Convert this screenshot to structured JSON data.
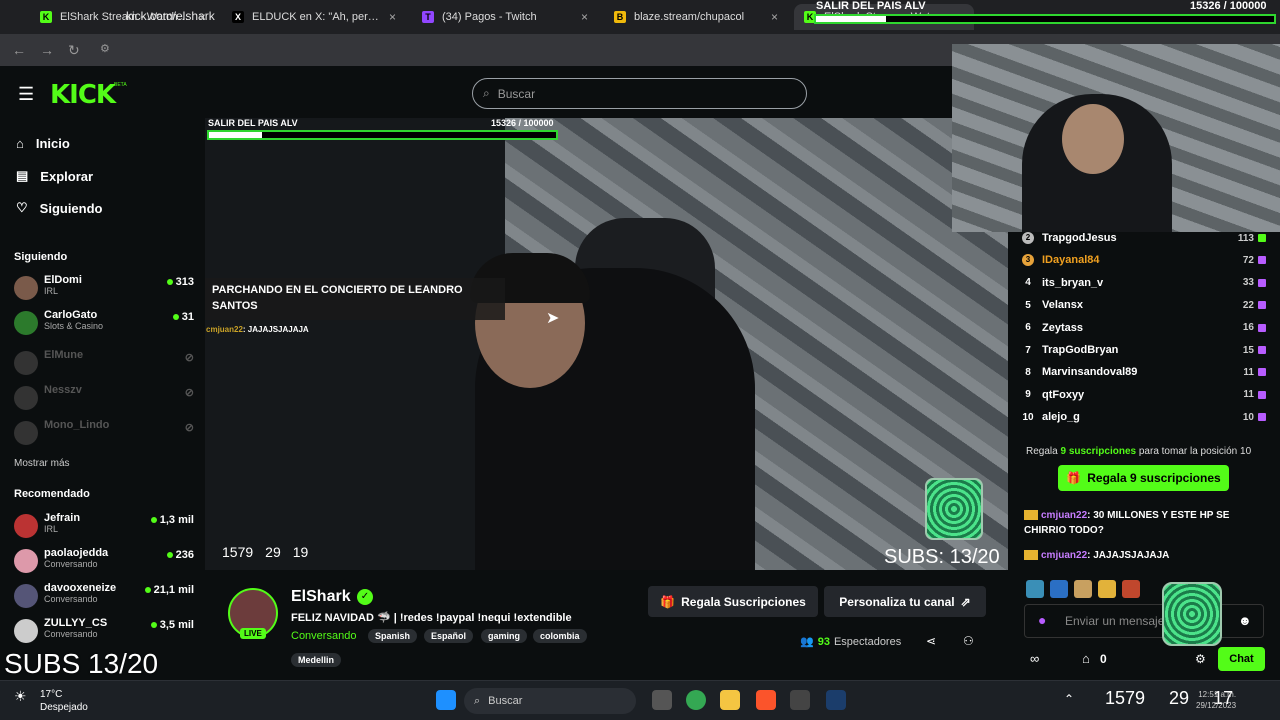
{
  "browser": {
    "tabs": [
      {
        "title": "ElShark Stream - Watch Live on",
        "color": "#53fc18",
        "icon": "K"
      },
      {
        "title": "ELDUCK en X: \"Ah, pero cómo",
        "color": "#000000",
        "icon": "X"
      },
      {
        "title": "(34) Pagos - Twitch",
        "color": "#9146ff",
        "icon": "T"
      },
      {
        "title": "blaze.stream/chupacol",
        "color": "#f0b90b",
        "icon": "B"
      },
      {
        "title": "ElShark Stream - Watch Live o",
        "color": "#53fc18",
        "icon": "K"
      }
    ],
    "url": "kick.com/elshark"
  },
  "kick": {
    "logo": "KICK",
    "beta": "BETA",
    "search_placeholder": "Buscar",
    "nav": [
      {
        "label": "Inicio",
        "icon": "home-icon",
        "glyph": "⌂"
      },
      {
        "label": "Explorar",
        "icon": "compass-icon",
        "glyph": "▤"
      },
      {
        "label": "Siguiendo",
        "icon": "heart-icon",
        "glyph": "♡"
      }
    ],
    "following_title": "Siguiendo",
    "following": [
      {
        "name": "ElDomi",
        "sub": "IRL",
        "count": "313",
        "online": true
      },
      {
        "name": "CarloGato",
        "sub": "Slots & Casino",
        "count": "31",
        "online": true
      },
      {
        "name": "ElMune",
        "sub": "",
        "count": "",
        "online": false
      },
      {
        "name": "Nesszv",
        "sub": "",
        "count": "",
        "online": false
      },
      {
        "name": "Mono_Lindo",
        "sub": "",
        "count": "",
        "online": false
      }
    ],
    "show_more": "Mostrar más",
    "recommended_title": "Recomendado",
    "recommended": [
      {
        "name": "Jefrain",
        "sub": "IRL",
        "count": "1,3 mil"
      },
      {
        "name": "paolaojedda",
        "sub": "Conversando",
        "count": "236"
      },
      {
        "name": "davooxeneize",
        "sub": "Conversando",
        "count": "21,1 mil"
      },
      {
        "name": "ZULLYY_CS",
        "sub": "Conversando",
        "count": "3,5 mil"
      }
    ]
  },
  "overlay": {
    "goal_label": "SALIR DEL PAIS ALV",
    "goal_count": "15326  / 100000",
    "goal_progress": 0.153,
    "pinned_message": "PARCHANDO EN EL CONCIERTO DE LEANDRO SANTOS",
    "chat_user": "cmjuan22",
    "chat_text": ": JAJAJSJAJAJA",
    "timer": [
      "1579",
      "29",
      "19"
    ],
    "subs": "SUBS: 13/20",
    "subs_big": "SUBS 13/20"
  },
  "channel": {
    "name": "ElShark",
    "live": "LIVE",
    "title": "FELIZ NAVIDAD 🦈 | !redes !paypal !nequi !extendible",
    "category": "Conversando",
    "tags": [
      "Spanish",
      "Español",
      "gaming",
      "colombia",
      "Medellin"
    ],
    "gift_button": "Regala Suscripciones",
    "customize_button": "Personaliza tu canal",
    "viewers_count": "93",
    "viewers_label": "Espectadores"
  },
  "leaderboard": [
    {
      "rank": "2",
      "name": "TrapgodJesus",
      "count": "113"
    },
    {
      "rank": "3",
      "name": "IDayanal84",
      "count": "72"
    },
    {
      "rank": "4",
      "name": "its_bryan_v",
      "count": "33"
    },
    {
      "rank": "5",
      "name": "Velansx",
      "count": "22"
    },
    {
      "rank": "6",
      "name": "Zeytass",
      "count": "16"
    },
    {
      "rank": "7",
      "name": "TrapGodBryan",
      "count": "15"
    },
    {
      "rank": "8",
      "name": "Marvinsandoval89",
      "count": "11"
    },
    {
      "rank": "9",
      "name": "qtFoxyy",
      "count": "11"
    },
    {
      "rank": "10",
      "name": "alejo_g",
      "count": "10"
    }
  ],
  "chat": {
    "gift_prompt_pre": "Regala",
    "gift_prompt_amount": "9 suscripciones",
    "gift_prompt_post": "para tomar la posición 10",
    "gift_button": "Regala 9 suscripciones",
    "messages": [
      {
        "user": "cmjuan22",
        "text": ": 30 MILLONES Y ESTE HP SE CHIRRIO TODO?"
      },
      {
        "user": "cmjuan22",
        "text": ": JAJAJSJAJAJA"
      }
    ],
    "input_placeholder": "Enviar un mensaje",
    "points": "0",
    "send_button": "Chat"
  },
  "taskbar": {
    "temp": "17°C",
    "weather": "Despejado",
    "search": "Buscar",
    "tray_overlay": [
      "1579",
      "29",
      "17"
    ],
    "time": "12:51 a.m.",
    "date": "29/12/2023"
  }
}
